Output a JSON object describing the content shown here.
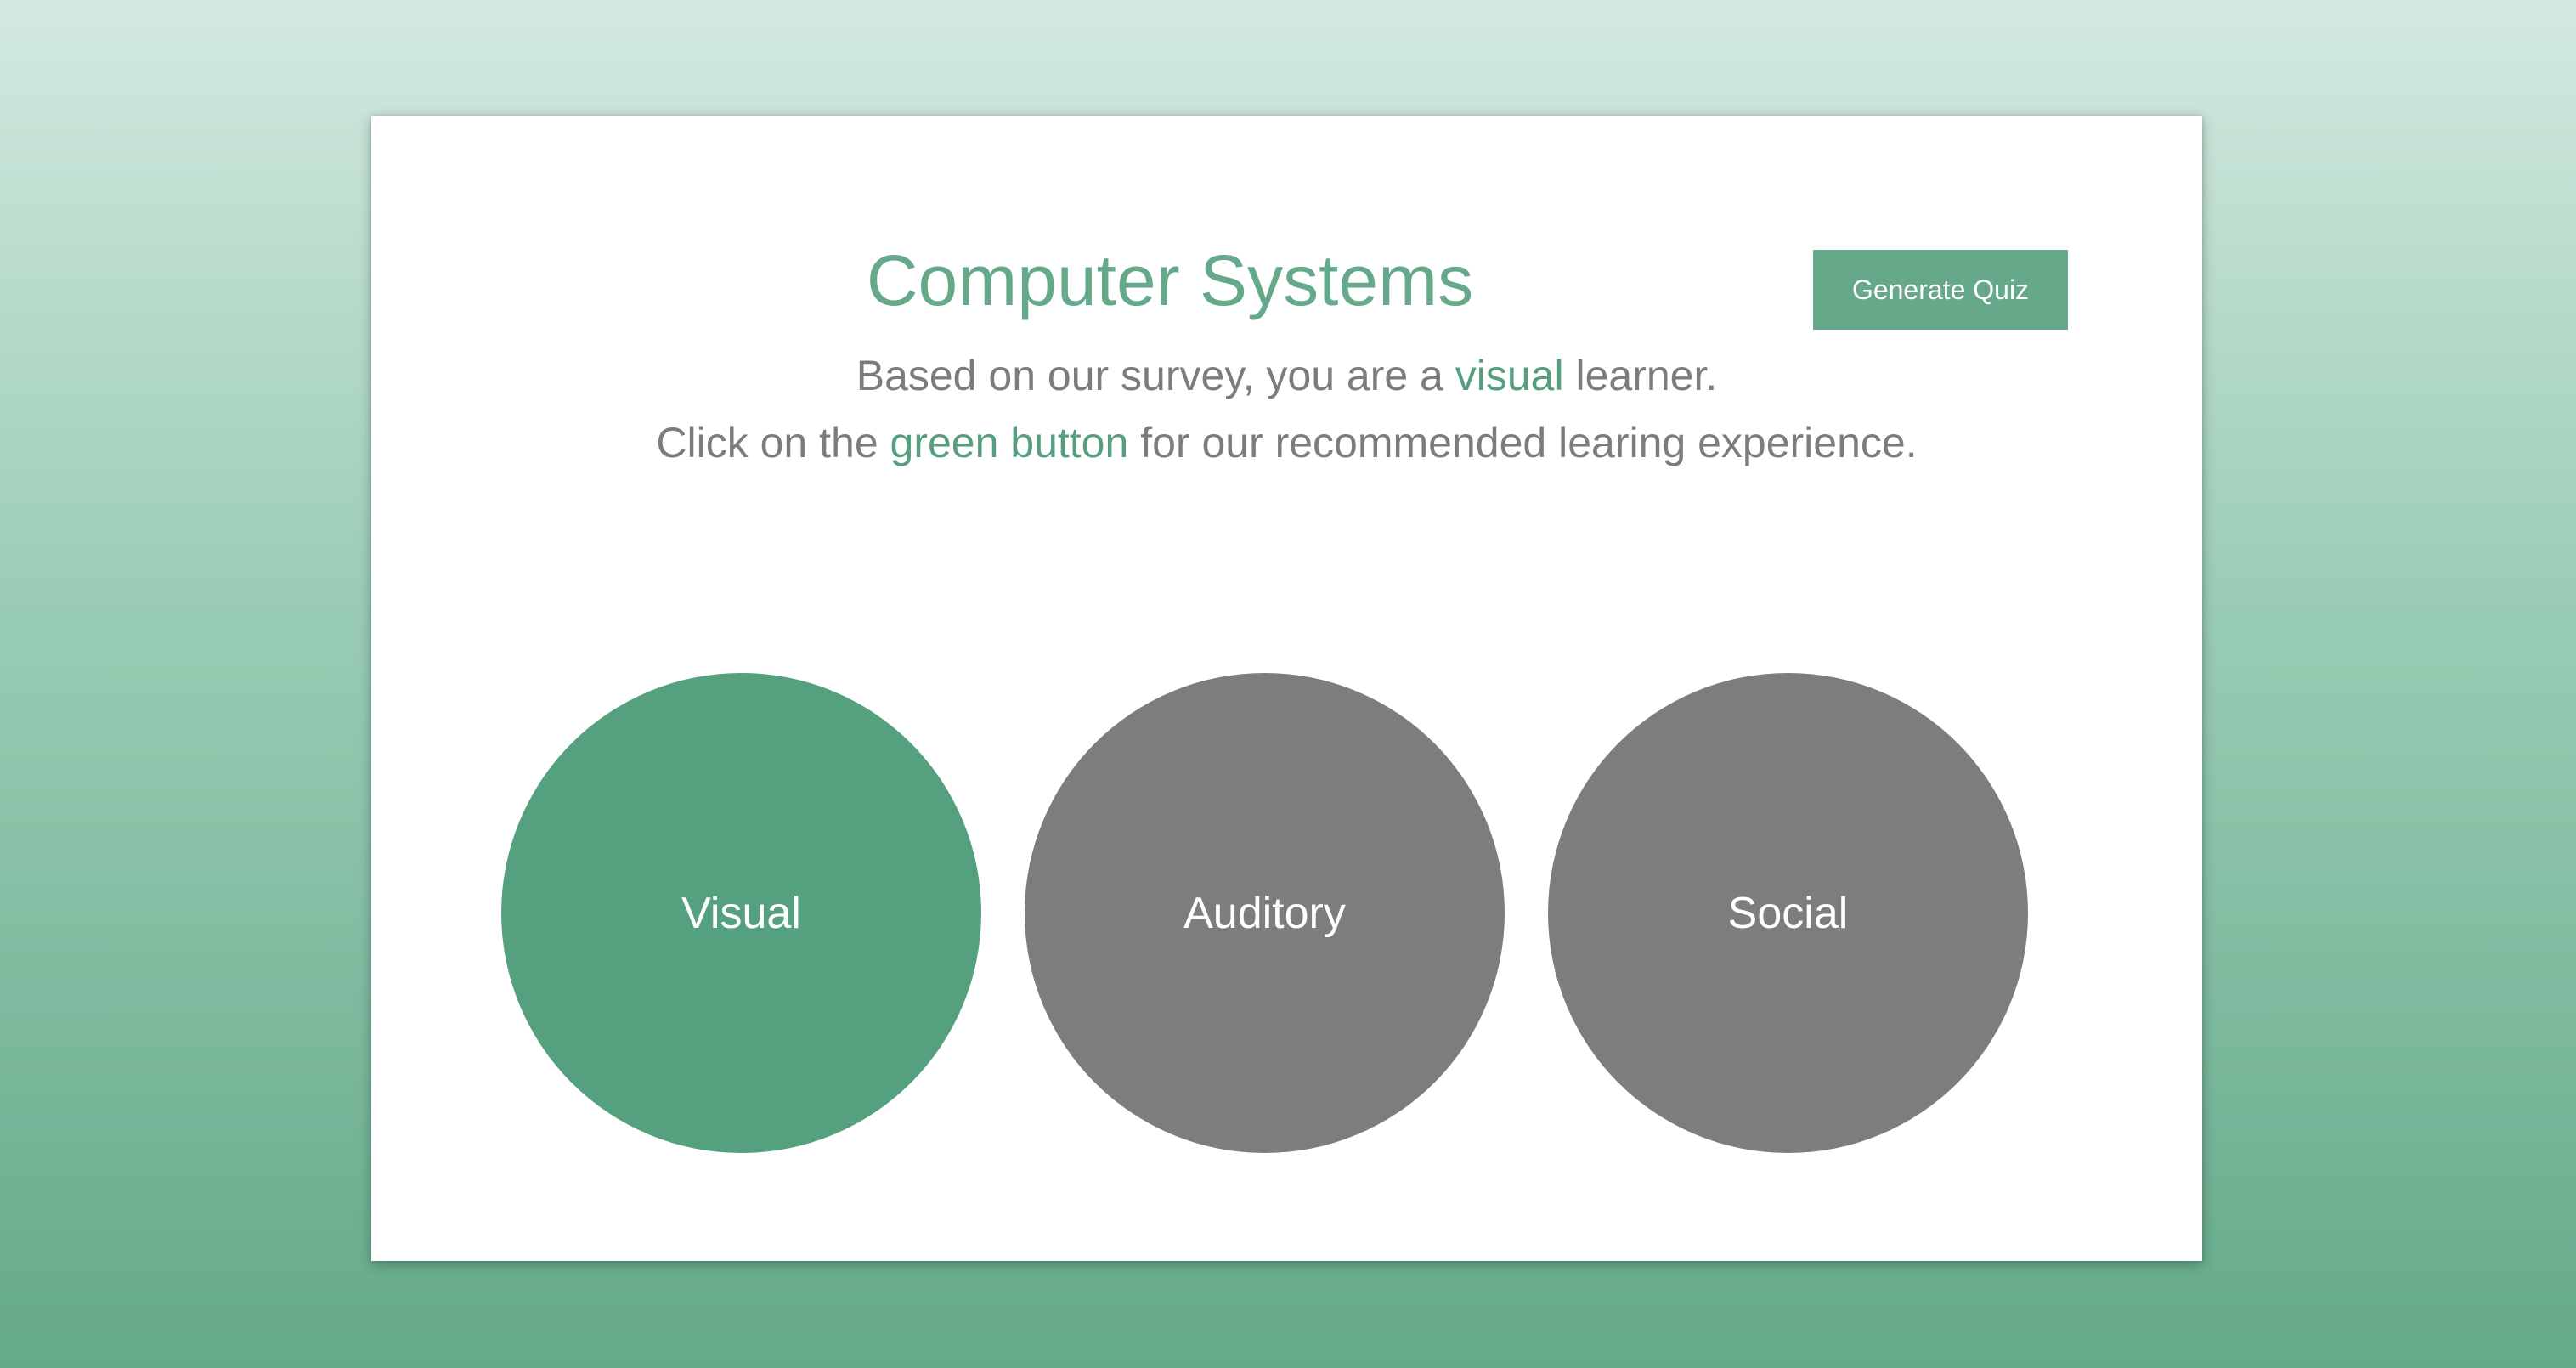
{
  "page": {
    "title": "Computer Systems",
    "generate_quiz_label": "Generate Quiz"
  },
  "message": {
    "line1_prefix": "Based on our survey, you are a ",
    "line1_highlight": "visual",
    "line1_suffix": " learner.",
    "line2_prefix": "Click on the ",
    "line2_highlight": "green button",
    "line2_suffix": " for our recommended learing experience."
  },
  "learning_styles": [
    {
      "label": "Visual",
      "recommended": true
    },
    {
      "label": "Auditory",
      "recommended": false
    },
    {
      "label": "Social",
      "recommended": false
    }
  ],
  "colors": {
    "accent": "#66a98a",
    "recommended_circle": "#55a07e",
    "other_circle": "#7d7d7d",
    "body_text": "#7c7c7c"
  }
}
